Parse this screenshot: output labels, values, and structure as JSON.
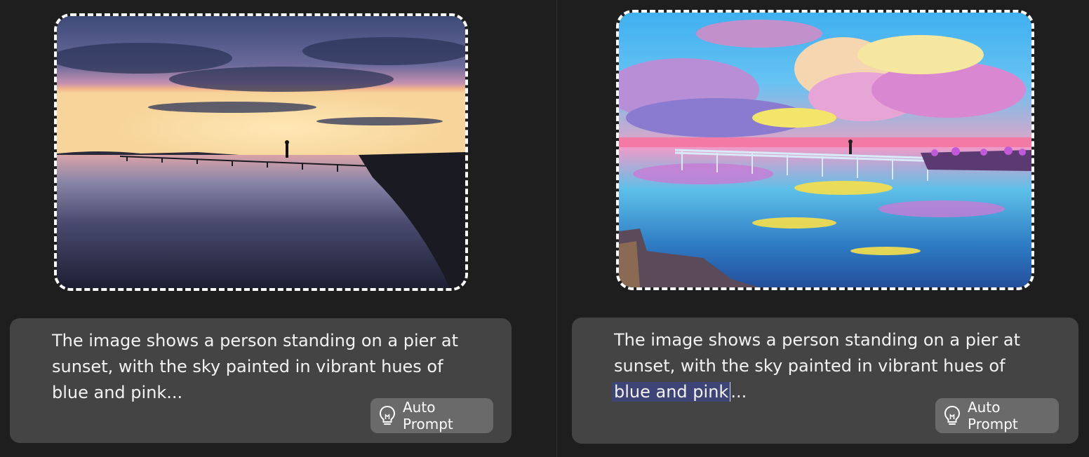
{
  "left": {
    "caption_line1": "The image shows a person standing on a pier at",
    "caption_line2": "sunset, with the sky painted in vibrant hues of",
    "caption_line3": "blue and pink...",
    "button_label": "Auto Prompt",
    "button_icon": "lightbulb-icon"
  },
  "right": {
    "caption_line1": "The image shows a person standing on a pier at",
    "caption_line2": "sunset, with the sky painted in vibrant hues of",
    "caption_highlight": "blue and pink",
    "caption_tail": "...",
    "button_label": "Auto Prompt",
    "button_icon": "lightbulb-icon"
  },
  "colors": {
    "background": "#1e1e1e",
    "prompt_box": "#444444",
    "button": "#6a6a6a",
    "selection": "#3e4476"
  }
}
